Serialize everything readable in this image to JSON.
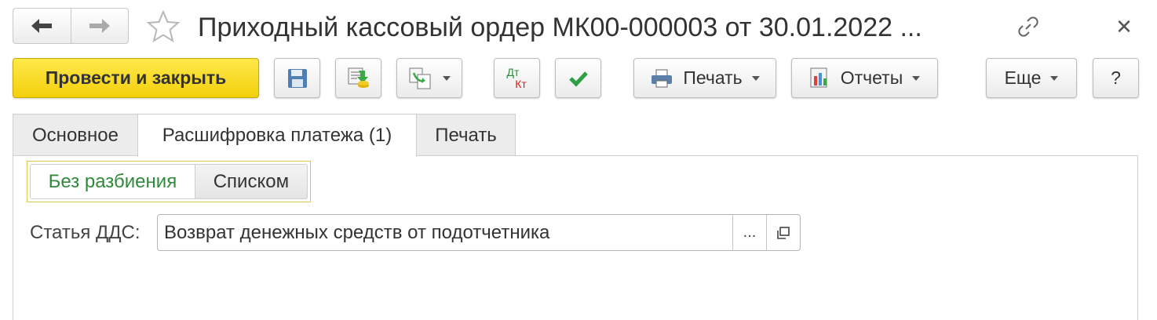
{
  "window": {
    "title": "Приходный кассовый ордер МК00-000003 от 30.01.2022 ..."
  },
  "toolbar": {
    "post_and_close_label": "Провести и закрыть",
    "print_label": "Печать",
    "reports_label": "Отчеты",
    "more_label": "Еще",
    "help_label": "?",
    "dtkt_top": "Дт",
    "dtkt_bottom": "Кт"
  },
  "tabs": [
    {
      "label": "Основное"
    },
    {
      "label": "Расшифровка платежа (1)"
    },
    {
      "label": "Печать"
    }
  ],
  "active_tab": 1,
  "split_mode": {
    "options": [
      "Без разбиения",
      "Списком"
    ],
    "selected": "Без разбиения"
  },
  "fields": {
    "dds_item": {
      "label": "Статья ДДС:",
      "value": "Возврат денежных средств от подотчетника",
      "select_button": "..."
    }
  },
  "colors": {
    "primary_button": "#f5d410",
    "selected_option_text": "#2f8a3a",
    "dt_color": "#2f8a3a",
    "kt_color": "#d02020"
  }
}
